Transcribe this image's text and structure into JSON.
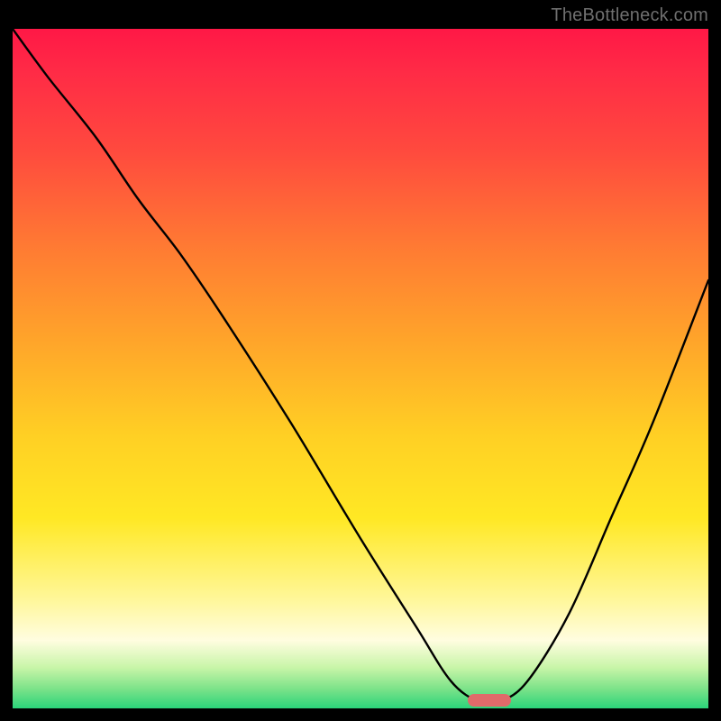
{
  "watermark": "TheBottleneck.com",
  "chart_data": {
    "type": "line",
    "title": "",
    "xlabel": "",
    "ylabel": "",
    "xlim": [
      0,
      100
    ],
    "ylim": [
      0,
      100
    ],
    "grid": false,
    "legend": false,
    "series": [
      {
        "name": "bottleneck-curve",
        "x": [
          0,
          5,
          12,
          18,
          24,
          30,
          40,
          50,
          58,
          63,
          67,
          70,
          74,
          80,
          86,
          92,
          100
        ],
        "values": [
          100,
          93,
          84,
          75,
          67,
          58,
          42,
          25,
          12,
          4,
          1,
          1,
          4,
          14,
          28,
          42,
          63
        ]
      }
    ],
    "annotations": [
      {
        "name": "optimal-marker",
        "x": 68.5,
        "y": 1.2,
        "color": "#e06a6a"
      }
    ],
    "background_gradient": [
      {
        "pos": 0.0,
        "color": "#ff1846"
      },
      {
        "pos": 0.32,
        "color": "#ff7a33"
      },
      {
        "pos": 0.6,
        "color": "#ffd024"
      },
      {
        "pos": 0.9,
        "color": "#fffde0"
      },
      {
        "pos": 1.0,
        "color": "#2bd47a"
      }
    ]
  }
}
